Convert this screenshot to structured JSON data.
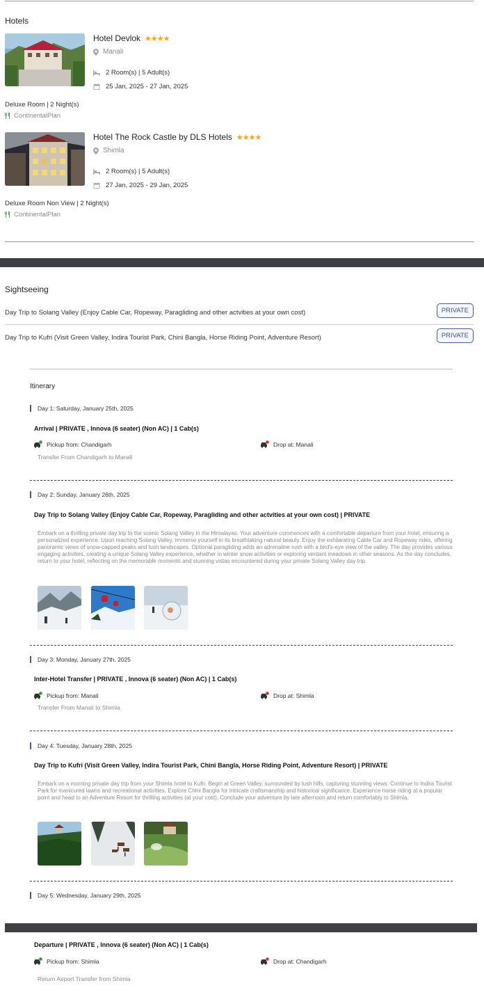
{
  "hotels": {
    "title": "Hotels",
    "items": [
      {
        "name": "Hotel Devlok",
        "stars": "★★★★",
        "location": "Manali",
        "rooms": "2 Room(s) | 5 Adult(s)",
        "dates": "25 Jan, 2025 - 27 Jan, 2025",
        "room_type": "Deluxe Room | 2 Night(s)",
        "plan": "ContinentalPlan"
      },
      {
        "name": "Hotel The Rock Castle by DLS Hotels",
        "stars": "★★★★",
        "location": "Shimla",
        "rooms": "2 Room(s) | 5 Adult(s)",
        "dates": "27 Jan, 2025 - 29 Jan, 2025",
        "room_type": "Deluxe Room Non View | 2 Night(s)",
        "plan": "ContinentalPlan"
      }
    ]
  },
  "sightseeing": {
    "title": "Sightseeing",
    "items": [
      {
        "label": "Day Trip to Solang Valley (Enjoy Cable Car, Ropeway, Paragliding and other actvities at your own cost)",
        "badge": "PRIVATE"
      },
      {
        "label": "Day Trip to Kufri (Visit Green Valley, Indira Tourist Park, Chini Bangla, Horse Riding Point, Adventure Resort)",
        "badge": "PRIVATE"
      }
    ]
  },
  "itinerary": {
    "title": "Itinerary",
    "days": [
      {
        "day": "Day 1: Saturday, January 25th, 2025",
        "service": "Arrival | PRIVATE , Innova (6 seater) (Non AC) | 1 Cab(s)",
        "pickup": "Pickup from: Chandigarh",
        "drop": "Drop at: Manali",
        "note": "Transfer From Chandigarh to Manali"
      },
      {
        "day": "Day 2: Sunday, January 26th, 2025",
        "service": "Day Trip to Solang Valley (Enjoy Cable Car, Ropeway, Paragliding and other actvities at your own cost) | PRIVATE",
        "description": "Embark on a thrilling private day trip to the scenic Solang Valley in the Himalayas. Your adventure commences with a comfortable departure from your hotel, ensuring a personalized experience. Upon reaching Solang Valley, immerse yourself in its breathtaking natural beauty. Enjoy the exhilarating Cable Car and Ropeway rides, offering panoramic views of snow-capped peaks and lush landscapes. Optional paragliding adds an adrenaline rush with a bird's-eye view of the valley. The day provides various engaging activities, creating a unique Solang Valley experience, whether in winter snow activities or exploring verdant meadows in other seasons. As the day concludes, return to your hotel, reflecting on the memorable moments and stunning vistas encountered during your private Solang Valley day trip."
      },
      {
        "day": "Day 3: Monday, January 27th, 2025",
        "service": "Inter-Hotel Transfer | PRIVATE , Innova (6 seater) (Non AC) | 1 Cab(s)",
        "pickup": "Pickup from: Manali",
        "drop": "Drop at: Shimla",
        "note": "Transfer From Manali to Shimla"
      },
      {
        "day": "Day 4: Tuesday, January 28th, 2025",
        "service": "Day Trip to Kufri (Visit Green Valley, Indira Tourist Park, Chini Bangla, Horse Riding Point, Adventure Resort) | PRIVATE",
        "description": "Embark on a morning private day trip from your Shimla hotel to Kufri. Begin at Green Valley, surrounded by lush hills, capturing stunning views. Continue to Indira Tourist Park for manicured lawns and recreational activities. Explore Chini Bangla for intricate craftsmanship and historical significance. Experience horse riding at a popular point and head to an Adventure Resort for thrilling activities (at your cost). Conclude your adventure by late afternoon and return comfortably to Shimla."
      },
      {
        "day": "Day 5: Wednesday, January 29th, 2025",
        "service": "Departure | PRIVATE , Innova (6 seater) (Non AC) | 1 Cab(s)",
        "pickup": "Pickup from: Shimla",
        "drop": "Drop at: Chandigarh",
        "note": "Return Airport Transfer from Shimla"
      }
    ]
  },
  "colors": {
    "accent": "#3e4f86",
    "star": "#f2a31d",
    "pickup_green": "#2f9a3b",
    "drop_red": "#d9302f",
    "divider_dark": "#3d4146"
  }
}
